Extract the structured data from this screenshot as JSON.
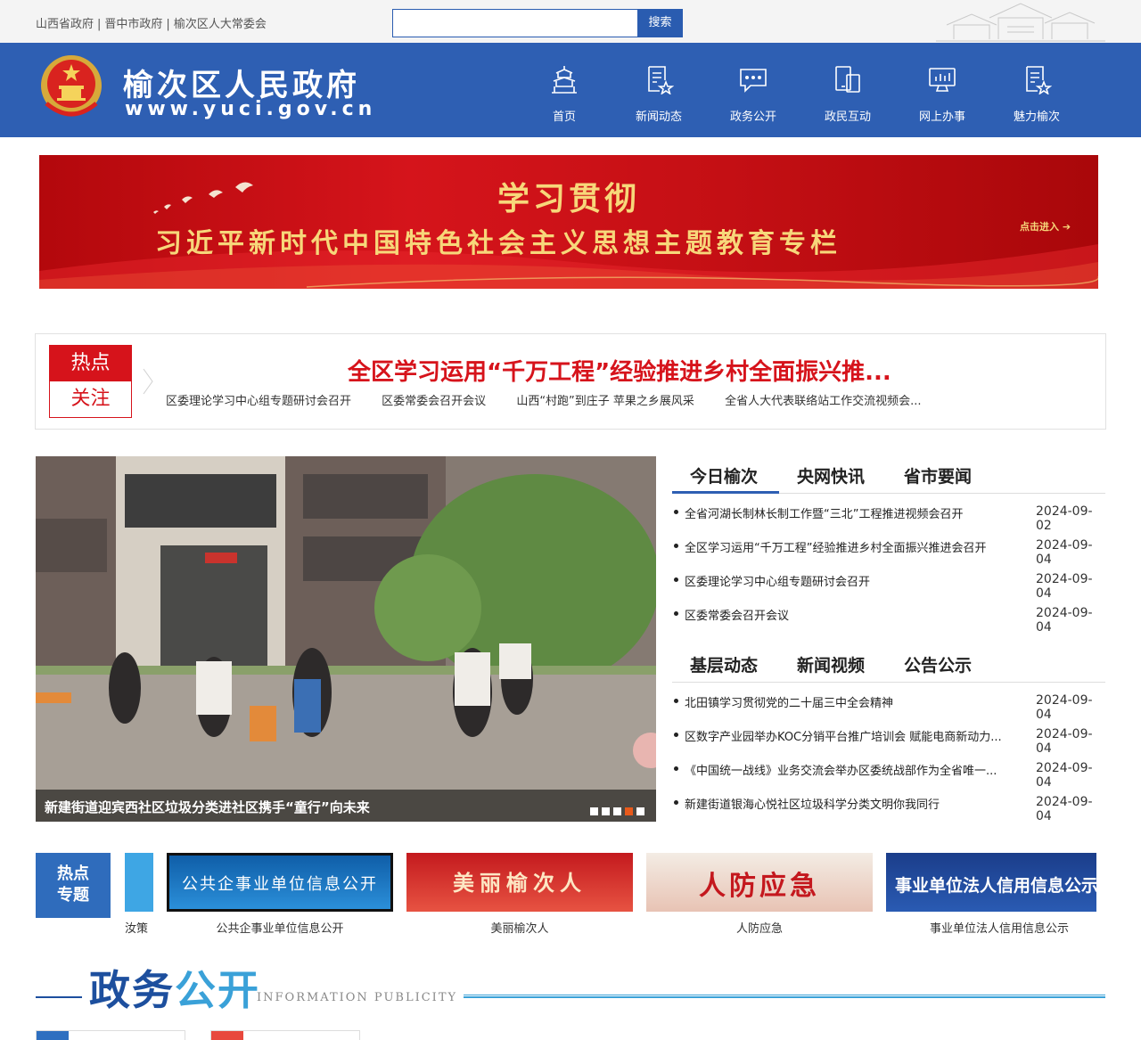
{
  "top_links": [
    "山西省政府",
    "晋中市政府",
    "榆次区人大常委会"
  ],
  "search": {
    "placeholder": "",
    "button": "搜索"
  },
  "header": {
    "title": "榆次区人民政府",
    "url": "www.yuci.gov.cn",
    "nav": [
      {
        "label": "首页",
        "icon": "pagoda-icon"
      },
      {
        "label": "新闻动态",
        "icon": "news-doc-icon"
      },
      {
        "label": "政务公开",
        "icon": "chat-bubble-icon"
      },
      {
        "label": "政民互动",
        "icon": "devices-icon"
      },
      {
        "label": "网上办事",
        "icon": "monitor-icon"
      },
      {
        "label": "魅力榆次",
        "icon": "star-doc-icon"
      }
    ]
  },
  "banner": {
    "title": "学习贯彻",
    "subtitle": "习近平新时代中国特色社会主义思想主题教育专栏",
    "enter": "点击进入"
  },
  "hot": {
    "badge_top": "热点",
    "badge_bottom": "关注",
    "headline": "全区学习运用“千万工程”经验推进乡村全面振兴推...",
    "links": [
      "区委理论学习中心组专题研讨会召开",
      "区委常委会召开会议",
      "山西“村跑”到庄子 苹果之乡展风采",
      "全省人大代表联络站工作交流视频会..."
    ]
  },
  "carousel": {
    "caption": "新建街道迎宾西社区垃圾分类进社区携手“童行”向未来",
    "dots": 5,
    "active_dot": 4
  },
  "news_panel_1": {
    "tabs": [
      "今日榆次",
      "央网快讯",
      "省市要闻"
    ],
    "items": [
      {
        "title": "全省河湖长制林长制工作暨“三北”工程推进视频会召开",
        "date": "2024-09-02"
      },
      {
        "title": "全区学习运用“千万工程”经验推进乡村全面振兴推进会召开",
        "date": "2024-09-04"
      },
      {
        "title": "区委理论学习中心组专题研讨会召开",
        "date": "2024-09-04"
      },
      {
        "title": "区委常委会召开会议",
        "date": "2024-09-04"
      }
    ]
  },
  "news_panel_2": {
    "tabs": [
      "基层动态",
      "新闻视频",
      "公告公示"
    ],
    "items": [
      {
        "title": "北田镇学习贯彻党的二十届三中全会精神",
        "date": "2024-09-04"
      },
      {
        "title": "区数字产业园举办KOC分销平台推广培训会 赋能电商新动力...",
        "date": "2024-09-04"
      },
      {
        "title": "《中国统一战线》业务交流会举办区委统战部作为全省唯一...",
        "date": "2024-09-04"
      },
      {
        "title": "新建街道银海心悦社区垃圾科学分类文明你我同行",
        "date": "2024-09-04"
      }
    ]
  },
  "topics": {
    "label_line1": "热点",
    "label_line2": "专题",
    "partial_label": "汝策",
    "cards": [
      {
        "name": "公共企事业单位信息公开",
        "art": "公共企事业单位信息公开"
      },
      {
        "name": "美丽榆次人",
        "art": "美丽榆次人"
      },
      {
        "name": "人防应急",
        "art": "人防应急"
      },
      {
        "name": "事业单位法人信用信息公示",
        "art": "事业单位法人信用信息公示"
      }
    ]
  },
  "section": {
    "title_dark": "政务",
    "title_light": "公开",
    "title_en": "INFORMATION PUBLICITY"
  },
  "colors": {
    "brand_blue": "#2e5fb3",
    "hot_red": "#d6131b",
    "banner_gold": "#f7d77a"
  }
}
